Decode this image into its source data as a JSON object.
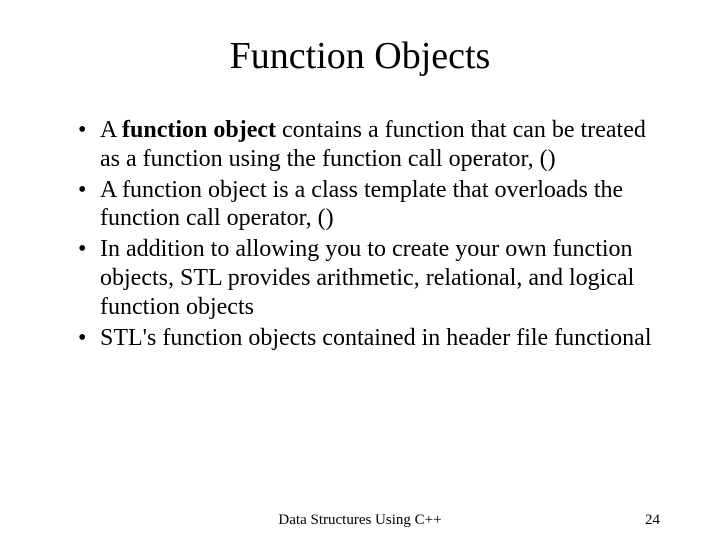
{
  "title": "Function Objects",
  "bullets": [
    {
      "prefix": "A ",
      "bold": "function object",
      "rest": " contains a function that can be treated as a function using the function call operator, ()"
    },
    {
      "prefix": "",
      "bold": "",
      "rest": "A function object is a class template that overloads the function call operator, ()"
    },
    {
      "prefix": "",
      "bold": "",
      "rest": "In addition to allowing you to create your own function objects, STL provides arithmetic, relational, and logical function objects"
    },
    {
      "prefix": "",
      "bold": "",
      "rest": "STL's function objects contained in header file functional"
    }
  ],
  "footer": {
    "center": "Data Structures Using C++",
    "right": "24"
  }
}
